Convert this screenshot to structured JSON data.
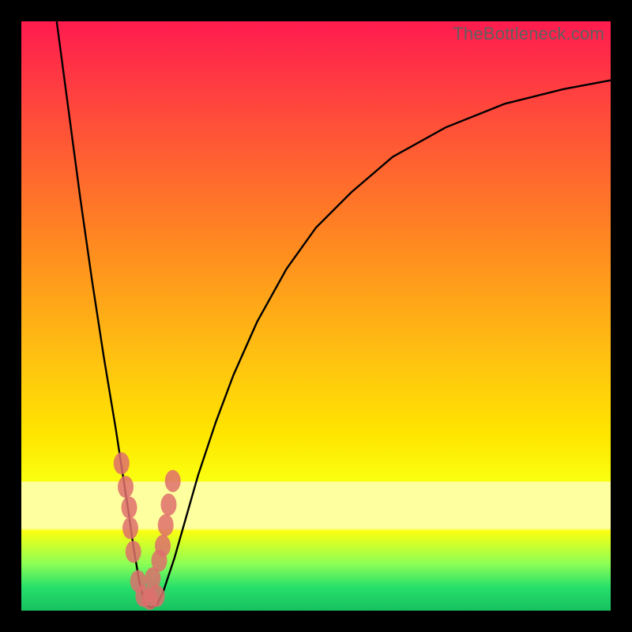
{
  "watermark": "TheBottleneck.com",
  "colors": {
    "frame": "#000000",
    "curve": "#000000",
    "marker_fill": "#de6f6c",
    "marker_stroke": "#de6f6c",
    "grad_top": "#ff1b4f",
    "grad_2": "#ff5138",
    "grad_3": "#ff8a20",
    "grad_4": "#ffc410",
    "grad_5": "#ffe500",
    "grad_6": "#faff10",
    "grad_band": "#feff9e",
    "grad_green1": "#8eff55",
    "grad_green2": "#27e06a",
    "grad_green3": "#17c060"
  },
  "chart_data": {
    "type": "line",
    "title": "",
    "xlabel": "",
    "ylabel": "",
    "xlim": [
      0,
      100
    ],
    "ylim": [
      0,
      100
    ],
    "series": [
      {
        "name": "bottleneck-curve",
        "x": [
          6,
          8,
          10,
          12,
          14,
          16,
          18,
          19,
          20,
          21,
          22,
          23,
          24,
          26,
          28,
          30,
          33,
          36,
          40,
          45,
          50,
          56,
          63,
          72,
          82,
          92,
          100
        ],
        "y": [
          100,
          85,
          70,
          56,
          43,
          31,
          18,
          11,
          5,
          1,
          0.5,
          1,
          3,
          9,
          16,
          23,
          32,
          40,
          49,
          58,
          65,
          71,
          77,
          82,
          86,
          88.5,
          90
        ]
      }
    ],
    "markers": {
      "name": "highlight-points",
      "x": [
        17.0,
        17.7,
        18.3,
        18.5,
        19.0,
        19.8,
        20.7,
        21.8,
        23.0,
        22.3,
        23.4,
        24.0,
        24.5,
        25.0,
        25.7
      ],
      "y": [
        25.0,
        21.0,
        17.5,
        14.0,
        10.0,
        5.0,
        2.5,
        2.0,
        2.5,
        5.5,
        8.5,
        11.0,
        14.5,
        18.0,
        22.0
      ]
    }
  }
}
